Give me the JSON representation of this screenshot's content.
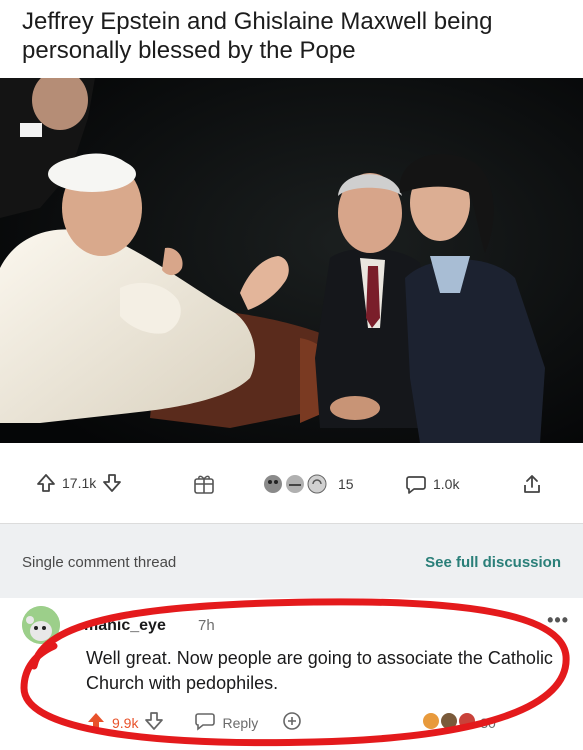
{
  "post": {
    "title": "Jeffrey Epstein and Ghislaine Maxwell being personally blessed by the Pope",
    "upvotes": "17.1k",
    "awards_count": "15",
    "comments": "1.0k"
  },
  "thread": {
    "label": "Single comment thread",
    "see_full": "See full discussion"
  },
  "comment": {
    "username": "manic_eye",
    "time": "7h",
    "text": "Well great. Now people are going to associate the Catholic Church with pedophiles.",
    "upvotes": "9.9k",
    "reply_label": "Reply",
    "right_count": "30"
  },
  "icons": {
    "upvote": "upvote-arrow-icon",
    "downvote": "downvote-arrow-icon",
    "award": "award-icon",
    "comments": "comment-bubble-icon",
    "share": "share-icon",
    "more": "more-options-icon"
  },
  "colors": {
    "accent_teal": "#2a7f79",
    "highlight_red": "#e41a1c",
    "upvote_active": "#e8522b"
  }
}
